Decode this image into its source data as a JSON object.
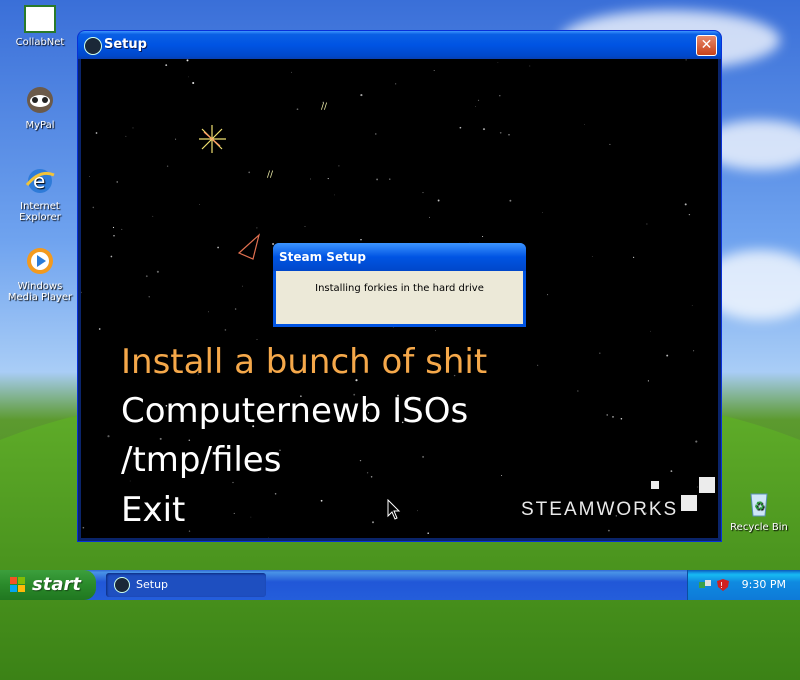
{
  "desktop": {
    "icons": [
      {
        "label": "CollabNet"
      },
      {
        "label": "MyPal"
      },
      {
        "label": "Internet Explorer"
      },
      {
        "label": "Windows Media Player"
      },
      {
        "label": "Recycle Bin"
      }
    ]
  },
  "window": {
    "title": "Setup",
    "close_symbol": "✕",
    "menu": [
      {
        "label": "Install a bunch of shit",
        "active": true
      },
      {
        "label": "Computernewb ISOs",
        "active": false
      },
      {
        "label": "/tmp/files",
        "active": false
      },
      {
        "label": "Exit",
        "active": false
      }
    ],
    "brand": "STEAMWORKS"
  },
  "dialog": {
    "title": "Steam Setup",
    "message": "Installing forkies in the hard drive"
  },
  "taskbar": {
    "start_label": "start",
    "tasks": [
      {
        "label": "Setup"
      }
    ],
    "clock": "9:30 PM"
  },
  "colors": {
    "menu_active": "#f5a84a",
    "menu_normal": "#ffffff",
    "taskbar_blue": "#245edb",
    "start_green": "#2a8a2a"
  }
}
